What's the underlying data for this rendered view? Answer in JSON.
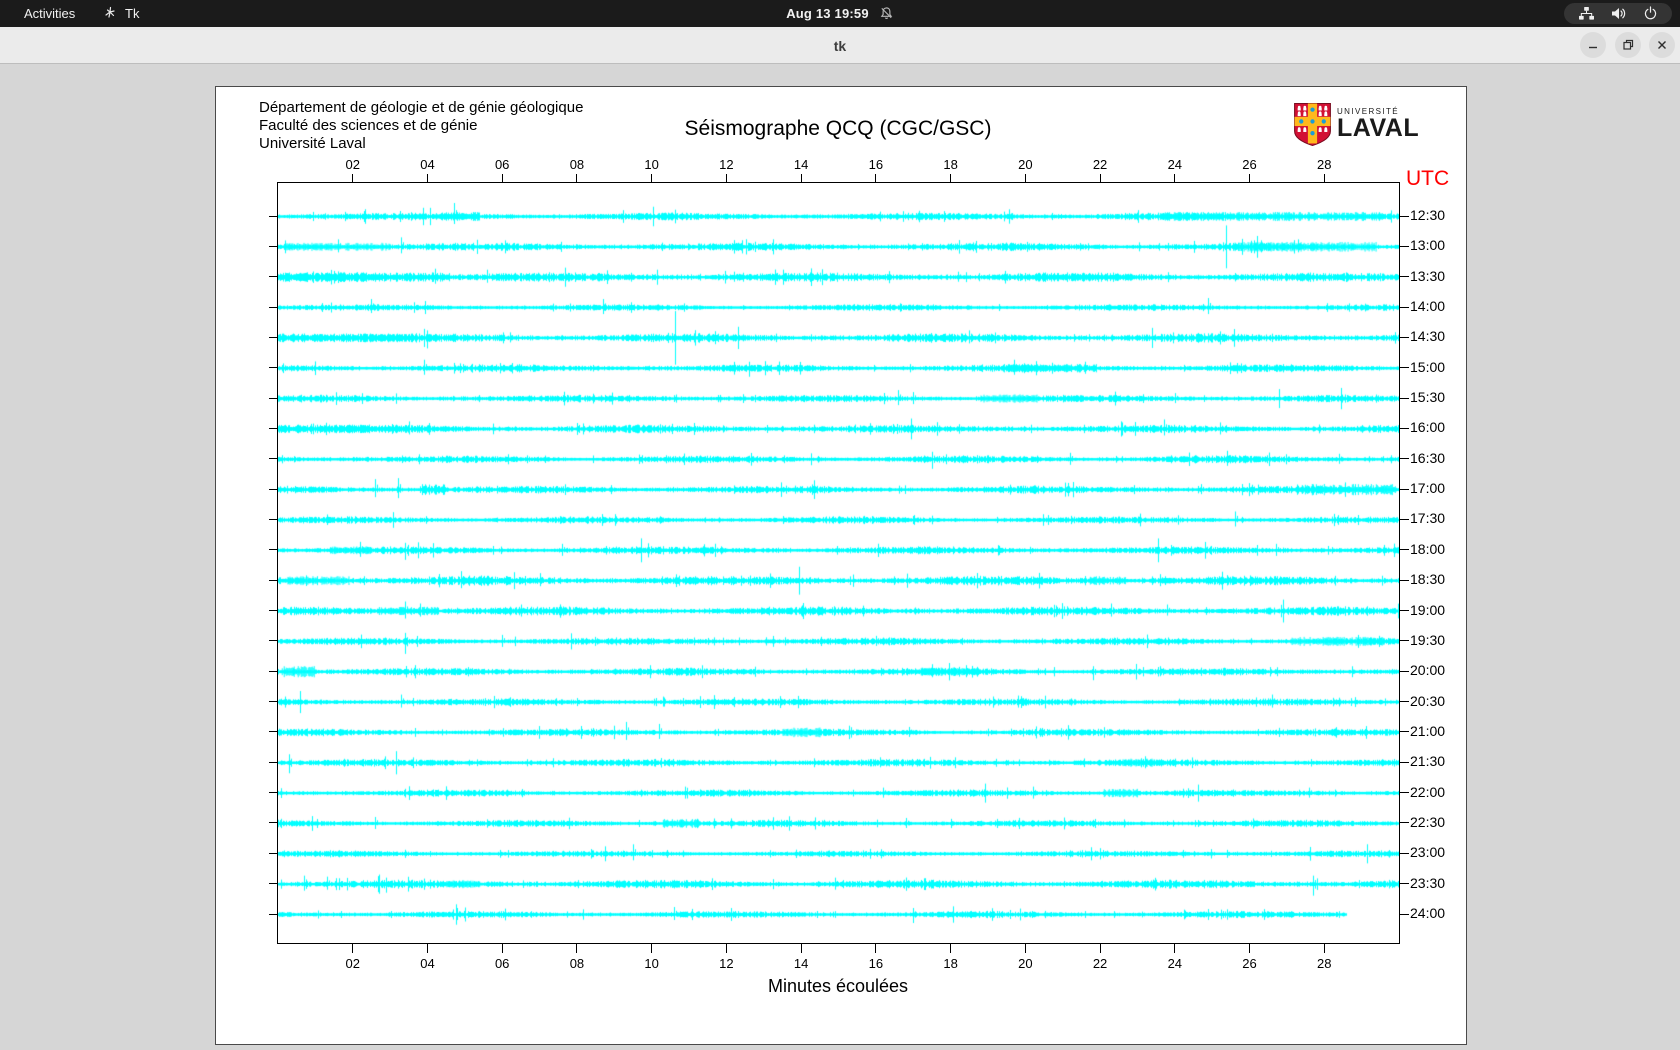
{
  "topbar": {
    "activities_label": "Activities",
    "app_indicator_label": "Tk",
    "clock_text": "Aug 13 19:59",
    "icons": [
      "tk-icon",
      "bell-slash-icon",
      "network-wired-icon",
      "volume-icon",
      "power-icon"
    ]
  },
  "titlebar": {
    "title": "tk"
  },
  "panel": {
    "header_lines": [
      "Département de géologie et de génie géologique",
      "Faculté des sciences et de génie",
      "Université Laval"
    ],
    "logo": {
      "line1": "UNIVERSITÉ",
      "line2": "LAVAL"
    }
  },
  "chart_data": {
    "type": "line",
    "title": "Séismographe QCQ (CGC/GSC)",
    "xlabel": "Minutes écoulées",
    "right_axis_label": "UTC",
    "x_range": [
      0,
      30
    ],
    "x_tick_minutes": [
      2,
      4,
      6,
      8,
      10,
      12,
      14,
      16,
      18,
      20,
      22,
      24,
      26,
      28
    ],
    "x_tick_labels": [
      "02",
      "04",
      "06",
      "08",
      "10",
      "12",
      "14",
      "16",
      "18",
      "20",
      "22",
      "24",
      "26",
      "28"
    ],
    "trace_color": "#00ffff",
    "utc_color": "#ff0000",
    "grid": false,
    "rows": [
      {
        "time": "12:30",
        "seed": 11,
        "amp": 1.6,
        "end": 30,
        "spikes": [
          [
            4.7,
            13,
            7
          ]
        ],
        "bursts": [
          [
            4.2,
            5.4,
            2.6
          ],
          [
            23.6,
            29.6,
            2.6
          ]
        ]
      },
      {
        "time": "13:00",
        "seed": 22,
        "amp": 1.7,
        "end": 30,
        "spikes": [
          [
            1.6,
            7,
            5
          ],
          [
            3.3,
            9,
            6
          ],
          [
            26.3,
            6,
            5
          ],
          [
            27.3,
            7,
            5
          ]
        ],
        "bursts": [
          [
            0.2,
            3.0,
            2.3
          ],
          [
            25.6,
            29.4,
            2.8
          ]
        ]
      },
      {
        "time": "13:30",
        "seed": 33,
        "amp": 2.0,
        "end": 30,
        "spikes": [
          [
            4.2,
            8,
            6
          ],
          [
            5.6,
            7,
            5
          ],
          [
            12.2,
            5,
            4
          ],
          [
            18.2,
            5,
            4
          ]
        ],
        "bursts": [
          [
            0,
            4.6,
            2.8
          ]
        ]
      },
      {
        "time": "14:00",
        "seed": 44,
        "amp": 1.3,
        "end": 30,
        "spikes": [
          [
            2.5,
            8,
            5
          ],
          [
            8.7,
            8,
            6
          ],
          [
            24.9,
            9,
            6
          ]
        ],
        "bursts": []
      },
      {
        "time": "14:30",
        "seed": 55,
        "amp": 1.9,
        "end": 30,
        "spikes": [
          [
            4.0,
            7,
            10
          ],
          [
            6.2,
            5,
            4
          ],
          [
            11.7,
            6,
            5
          ],
          [
            18.5,
            7,
            5
          ]
        ],
        "bursts": [
          [
            0,
            3.6,
            2.5
          ]
        ]
      },
      {
        "time": "15:00",
        "seed": 66,
        "amp": 1.6,
        "end": 30,
        "spikes": [
          [
            3.9,
            8,
            6
          ],
          [
            12.6,
            6,
            8
          ],
          [
            19.7,
            8,
            6
          ],
          [
            21.6,
            6,
            5
          ]
        ],
        "bursts": [
          [
            19.4,
            21.9,
            2.4
          ]
        ]
      },
      {
        "time": "15:30",
        "seed": 77,
        "amp": 1.5,
        "end": 30,
        "spikes": [
          [
            16.6,
            8,
            6
          ],
          [
            17.0,
            6,
            5
          ],
          [
            24.0,
            5,
            4
          ]
        ],
        "bursts": [
          [
            18.8,
            20.3,
            2.4
          ]
        ]
      },
      {
        "time": "16:00",
        "seed": 88,
        "amp": 1.7,
        "end": 30,
        "spikes": [
          [
            3.5,
            7,
            5
          ],
          [
            23.7,
            9,
            6
          ],
          [
            25.2,
            6,
            5
          ]
        ],
        "bursts": [
          [
            0,
            2.6,
            2.5
          ]
        ]
      },
      {
        "time": "16:30",
        "seed": 99,
        "amp": 1.5,
        "end": 30,
        "spikes": [
          [
            17.5,
            7,
            9
          ],
          [
            21.2,
            6,
            5
          ],
          [
            25.4,
            8,
            6
          ],
          [
            28.4,
            5,
            4
          ]
        ],
        "bursts": []
      },
      {
        "time": "17:00",
        "seed": 110,
        "amp": 1.6,
        "end": 30,
        "spikes": [
          [
            2.6,
            10,
            7
          ],
          [
            3.2,
            11,
            8
          ],
          [
            24.7,
            5,
            4
          ]
        ],
        "bursts": [
          [
            3.8,
            4.5,
            3.2
          ],
          [
            27.4,
            29.9,
            3.4
          ]
        ]
      },
      {
        "time": "17:30",
        "seed": 121,
        "amp": 1.4,
        "end": 30,
        "spikes": [
          [
            1.3,
            5,
            4
          ],
          [
            25.6,
            8,
            6
          ]
        ],
        "bursts": []
      },
      {
        "time": "18:00",
        "seed": 132,
        "amp": 1.6,
        "end": 30,
        "spikes": [
          [
            2.2,
            8,
            6
          ],
          [
            3.4,
            7,
            9
          ],
          [
            7.6,
            6,
            5
          ],
          [
            24.8,
            7,
            5
          ],
          [
            26.7,
            6,
            5
          ]
        ],
        "bursts": [
          [
            1.4,
            2.5,
            2.2
          ]
        ]
      },
      {
        "time": "18:30",
        "seed": 143,
        "amp": 2.0,
        "end": 30,
        "spikes": [
          [
            4.9,
            9,
            7
          ],
          [
            7.0,
            7,
            5
          ],
          [
            23.6,
            6,
            5
          ],
          [
            25.4,
            5,
            4
          ]
        ],
        "bursts": [
          [
            0.2,
            1.9,
            2.6
          ],
          [
            21.7,
            22.7,
            2.6
          ]
        ]
      },
      {
        "time": "19:00",
        "seed": 154,
        "amp": 1.9,
        "end": 30,
        "spikes": [
          [
            3.4,
            9,
            7
          ],
          [
            3.8,
            7,
            5
          ],
          [
            6.5,
            6,
            5
          ],
          [
            22.3,
            7,
            5
          ],
          [
            23.8,
            6,
            4
          ]
        ],
        "bursts": [
          [
            2.7,
            4.3,
            2.4
          ]
        ]
      },
      {
        "time": "19:30",
        "seed": 165,
        "amp": 1.5,
        "end": 30,
        "spikes": [
          [
            3.4,
            8,
            12
          ],
          [
            6.0,
            6,
            5
          ],
          [
            16.0,
            5,
            4
          ]
        ],
        "bursts": [
          [
            27.1,
            29.6,
            2.6
          ]
        ]
      },
      {
        "time": "20:00",
        "seed": 176,
        "amp": 1.6,
        "end": 30,
        "spikes": [
          [
            17.5,
            7,
            5
          ],
          [
            18.4,
            6,
            5
          ],
          [
            21.8,
            5,
            8
          ],
          [
            23.6,
            5,
            4
          ]
        ],
        "bursts": [
          [
            0.1,
            1.0,
            3.4
          ],
          [
            17.2,
            18.7,
            2.4
          ]
        ]
      },
      {
        "time": "20:30",
        "seed": 187,
        "amp": 1.5,
        "end": 30,
        "spikes": [
          [
            3.3,
            7,
            5
          ],
          [
            10.3,
            5,
            4
          ],
          [
            19.8,
            6,
            5
          ],
          [
            26.6,
            7,
            5
          ]
        ],
        "bursts": []
      },
      {
        "time": "21:00",
        "seed": 198,
        "amp": 1.5,
        "end": 30,
        "spikes": [
          [
            9.3,
            10,
            7
          ],
          [
            10.2,
            8,
            6
          ],
          [
            16.9,
            5,
            4
          ]
        ],
        "bursts": [
          [
            13.5,
            14.5,
            2.8
          ]
        ]
      },
      {
        "time": "21:30",
        "seed": 209,
        "amp": 1.5,
        "end": 30,
        "spikes": [
          [
            0.3,
            8,
            10
          ],
          [
            16.1,
            5,
            4
          ],
          [
            23.2,
            6,
            5
          ]
        ],
        "bursts": [
          [
            22.6,
            23.6,
            2.4
          ]
        ]
      },
      {
        "time": "22:00",
        "seed": 220,
        "amp": 1.4,
        "end": 30,
        "spikes": [
          [
            10.9,
            6,
            5
          ],
          [
            16.2,
            5,
            4
          ],
          [
            20.2,
            6,
            5
          ],
          [
            27.6,
            5,
            4
          ]
        ],
        "bursts": [
          [
            22.1,
            23.0,
            2.6
          ]
        ]
      },
      {
        "time": "22:30",
        "seed": 231,
        "amp": 1.4,
        "end": 30,
        "spikes": [
          [
            2.6,
            6,
            5
          ],
          [
            16.8,
            5,
            4
          ]
        ],
        "bursts": [
          [
            10.3,
            11.3,
            2.6
          ]
        ]
      },
      {
        "time": "23:00",
        "seed": 242,
        "amp": 1.3,
        "end": 30,
        "spikes": [
          [
            9.5,
            9,
            6
          ]
        ],
        "bursts": []
      },
      {
        "time": "23:30",
        "seed": 253,
        "amp": 1.8,
        "end": 30,
        "spikes": [
          [
            0.7,
            8,
            6
          ],
          [
            1.3,
            7,
            5
          ],
          [
            2.9,
            6,
            8
          ],
          [
            14.9,
            6,
            5
          ],
          [
            27.7,
            8,
            11
          ]
        ],
        "bursts": [
          [
            4.4,
            5.4,
            2.3
          ]
        ]
      },
      {
        "time": "24:00",
        "seed": 264,
        "amp": 1.4,
        "end": 28.6,
        "spikes": [
          [
            4.8,
            6,
            5
          ],
          [
            10.6,
            7,
            5
          ],
          [
            17.0,
            6,
            8
          ]
        ],
        "bursts": []
      }
    ]
  }
}
